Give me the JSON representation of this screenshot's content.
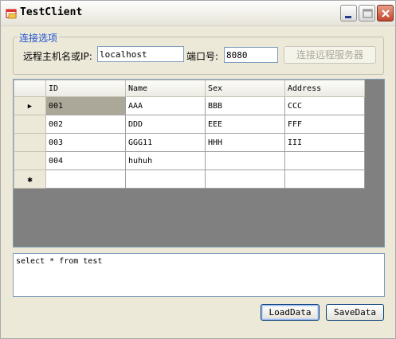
{
  "window": {
    "title": "TestClient",
    "controls": [
      "minimize-icon",
      "maximize-icon",
      "close-icon"
    ]
  },
  "connection": {
    "group_title": "连接选项",
    "host_label": "远程主机名或IP:",
    "host_value": "localhost",
    "port_label": "端口号:",
    "port_value": "8080",
    "connect_button": "连接远程服务器"
  },
  "grid": {
    "columns": [
      "ID",
      "Name",
      "Sex",
      "Address"
    ],
    "rows": [
      [
        "001",
        "AAA",
        "BBB",
        "CCC"
      ],
      [
        "002",
        "DDD",
        "EEE",
        "FFF"
      ],
      [
        "003",
        "GGG11",
        "HHH",
        "III"
      ],
      [
        "004",
        "huhuh",
        "",
        ""
      ]
    ],
    "current_row_marker": "▶",
    "new_row_marker": "✱"
  },
  "query": {
    "text": "select * from test"
  },
  "actions": {
    "load_label": "LoadData",
    "save_label": "SaveData"
  },
  "colors": {
    "accent": "#1f4fd1",
    "grid_background": "#808080",
    "selection": "#aca899"
  }
}
